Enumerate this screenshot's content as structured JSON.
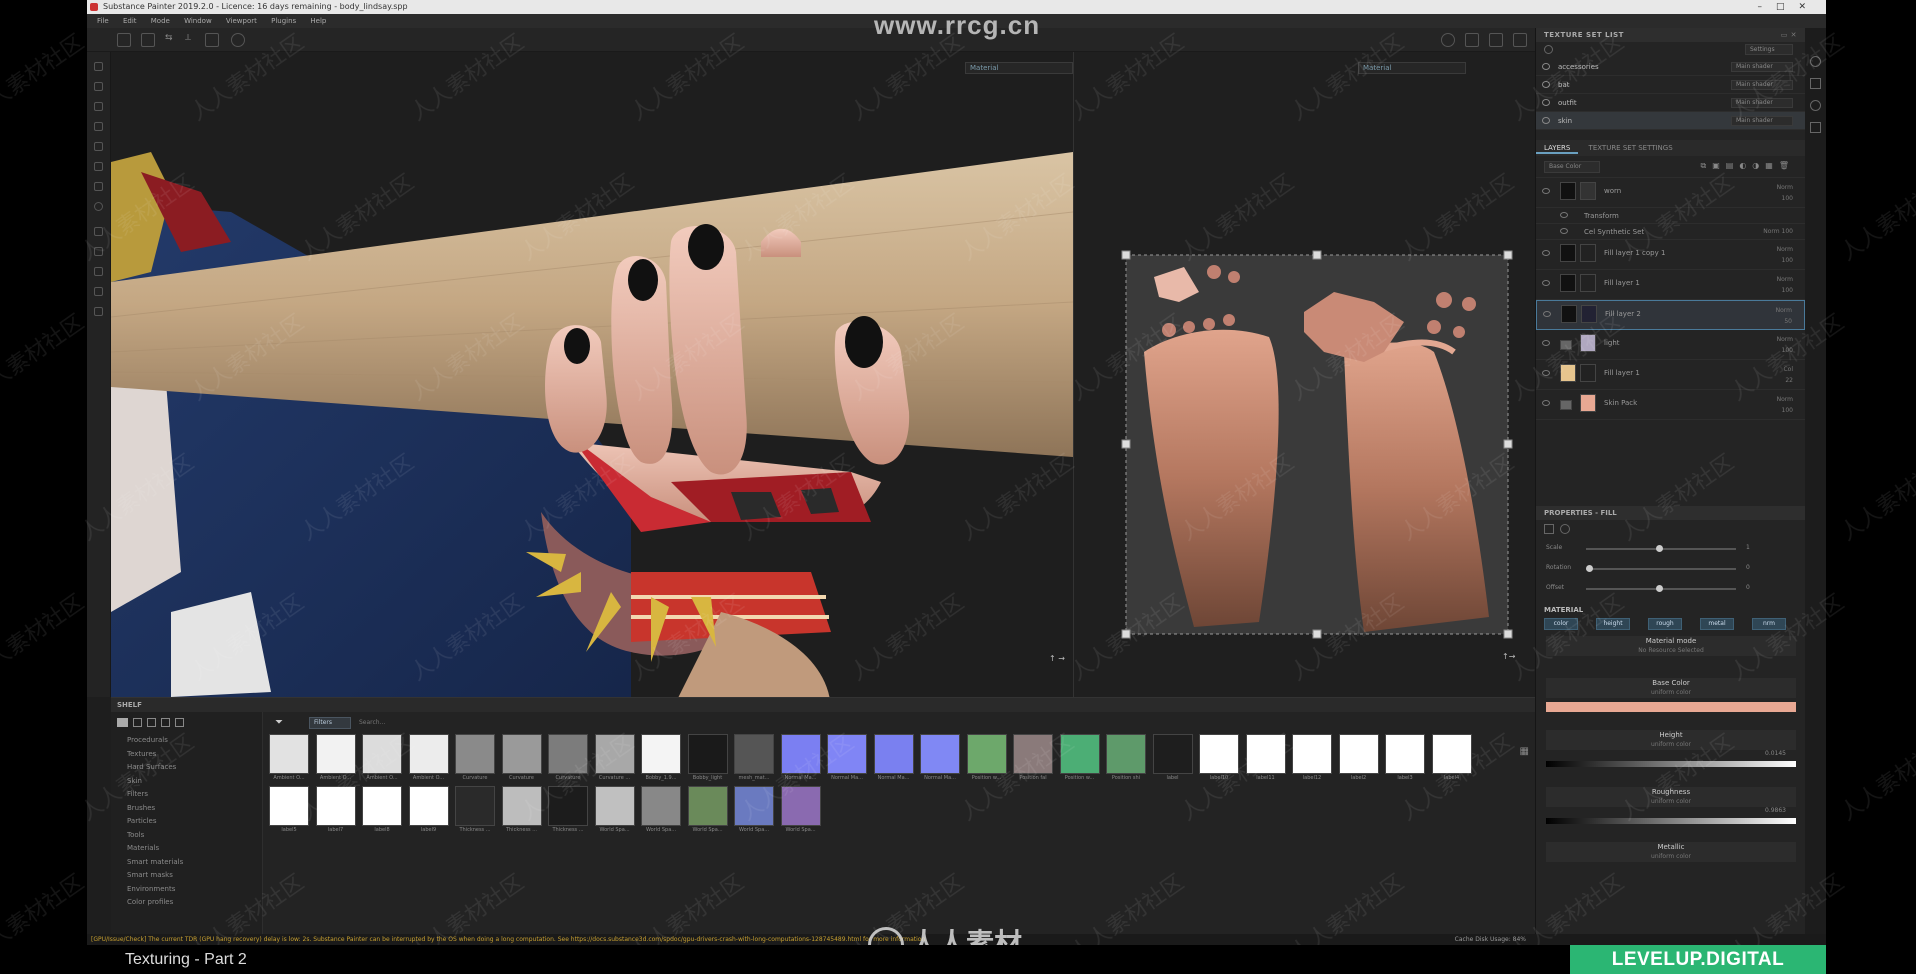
{
  "window": {
    "title": "Substance Painter 2019.2.0 - Licence: 16 days remaining - body_lindsay.spp"
  },
  "menu": [
    "File",
    "Edit",
    "Mode",
    "Window",
    "Viewport",
    "Plugins",
    "Help"
  ],
  "viewport3d": {
    "display_select": "Material"
  },
  "viewport2d": {
    "display_select": "Material"
  },
  "texture_set_list": {
    "title": "TEXTURE SET LIST",
    "settings_label": "Settings",
    "rows": [
      {
        "name": "accessories",
        "shader": "Main shader"
      },
      {
        "name": "bat",
        "shader": "Main shader"
      },
      {
        "name": "outfit",
        "shader": "Main shader"
      },
      {
        "name": "skin",
        "shader": "Main shader"
      }
    ]
  },
  "layers_panel": {
    "tabs": [
      "LAYERS",
      "TEXTURE SET SETTINGS"
    ],
    "channel_select": "Base Color",
    "rows": [
      {
        "name": "worn",
        "mode": "Norm",
        "opacity": "100"
      },
      {
        "name": "Transform",
        "mode": "",
        "opacity": ""
      },
      {
        "name": "Cel Synthetic Set",
        "mode": "Norm",
        "opacity": "100"
      },
      {
        "name": "Fill layer 1 copy 1",
        "mode": "Norm",
        "opacity": "100"
      },
      {
        "name": "Fill layer 1",
        "mode": "Norm",
        "opacity": "100"
      },
      {
        "name": "Fill layer 2",
        "mode": "Norm",
        "opacity": "50"
      },
      {
        "name": "light",
        "mode": "Norm",
        "opacity": "100"
      },
      {
        "name": "Fill layer 1",
        "mode": "Col",
        "opacity": "22"
      },
      {
        "name": "Skin Pack",
        "mode": "Norm",
        "opacity": "100"
      }
    ]
  },
  "properties": {
    "title": "PROPERTIES - FILL",
    "sliders": [
      {
        "label": "Scale",
        "value": "1",
        "level": 0.5
      },
      {
        "label": "Rotation",
        "value": "0",
        "level": 0.0
      },
      {
        "label": "Offset",
        "value": "0",
        "level": 0.5
      }
    ],
    "material_label": "MATERIAL",
    "material_buttons": [
      "color",
      "height",
      "rough",
      "metal",
      "nrm"
    ],
    "material_mode": "Material mode",
    "material_mode_value": "No Resource Selected",
    "channels": [
      {
        "name": "Base Color",
        "sub": "uniform color",
        "color": "#e8a893"
      },
      {
        "name": "Height",
        "sub": "uniform color",
        "value": "0.0145"
      },
      {
        "name": "Roughness",
        "sub": "uniform color",
        "value": "0.9863"
      },
      {
        "name": "Metallic",
        "sub": "uniform color"
      }
    ]
  },
  "shelf": {
    "title": "SHELF",
    "filter_chip": "Filters",
    "search_placeholder": "Search...",
    "categories": [
      "Procedurals",
      "Textures",
      "Hard Surfaces",
      "Skin",
      "Filters",
      "Brushes",
      "Particles",
      "Tools",
      "Materials",
      "Smart materials",
      "Smart masks",
      "Environments",
      "Color profiles"
    ],
    "row1": [
      {
        "label": "Ambient O...",
        "color": "#e2e2e2"
      },
      {
        "label": "Ambient O...",
        "color": "#f2f2f2"
      },
      {
        "label": "Ambient O...",
        "color": "#dcdcdc"
      },
      {
        "label": "Ambient O...",
        "color": "#ececec"
      },
      {
        "label": "Curvature",
        "color": "#8a8a8a"
      },
      {
        "label": "Curvature",
        "color": "#9a9a9a"
      },
      {
        "label": "Curvature",
        "color": "#7c7c7c"
      },
      {
        "label": "Curvature ...",
        "color": "#a8a8a8"
      },
      {
        "label": "Bobby_1.9...",
        "color": "#f4f4f4"
      },
      {
        "label": "Bobby_light",
        "color": "#1a1a1a"
      },
      {
        "label": "mesh_mat...",
        "color": "#555555"
      },
      {
        "label": "Normal Ma...",
        "color": "#7b7ff2"
      },
      {
        "label": "Normal Ma...",
        "color": "#8085f5"
      },
      {
        "label": "Normal Ma...",
        "color": "#7a80f0"
      },
      {
        "label": "Normal Ma...",
        "color": "#8088f4"
      },
      {
        "label": "Position w...",
        "color": "#6da86b"
      },
      {
        "label": "Position fal",
        "color": "#8a7a7a"
      },
      {
        "label": "Position w...",
        "color": "#4cae75"
      },
      {
        "label": "Position shi",
        "color": "#5e9a6a"
      },
      {
        "label": "label",
        "color": "#1e1e1e"
      },
      {
        "label": "label10",
        "color": "#ffffff"
      },
      {
        "label": "label11",
        "color": "#ffffff"
      },
      {
        "label": "label12",
        "color": "#ffffff"
      },
      {
        "label": "label2",
        "color": "#ffffff"
      },
      {
        "label": "label3",
        "color": "#ffffff"
      },
      {
        "label": "label4",
        "color": "#ffffff"
      }
    ],
    "row2": [
      {
        "label": "label5",
        "color": "#ffffff"
      },
      {
        "label": "label7",
        "color": "#ffffff"
      },
      {
        "label": "label8",
        "color": "#ffffff"
      },
      {
        "label": "label9",
        "color": "#ffffff"
      },
      {
        "label": "Thickness ...",
        "color": "#2a2a2a"
      },
      {
        "label": "Thickness ...",
        "color": "#bdbdbd"
      },
      {
        "label": "Thickness ...",
        "color": "#1c1c1c"
      },
      {
        "label": "World Spa...",
        "color": "#c0c0c0"
      },
      {
        "label": "World Spa...",
        "color": "#888888"
      },
      {
        "label": "World Spa...",
        "color": "#6a8a5a"
      },
      {
        "label": "World Spa...",
        "color": "#6a7ac0"
      },
      {
        "label": "World Spa...",
        "color": "#8a6ab0"
      }
    ]
  },
  "status": "[GPU/Issue/Check] The current TDR (GPU hang recovery) delay is low: 2s. Substance Painter can be interrupted by the OS when doing a long computation. See https://docs.substance3d.com/spdoc/gpu-drivers-crash-with-long-computations-128745489.html for more information.",
  "status_right": "Cache Disk Usage: 84%",
  "caption": "Texturing - Part 2",
  "brand": "LEVELUP.DIGITAL",
  "watermark_top": "www.rrcg.cn",
  "watermark_bottom": "人人素材",
  "watermark_tile": "人人素材社区"
}
